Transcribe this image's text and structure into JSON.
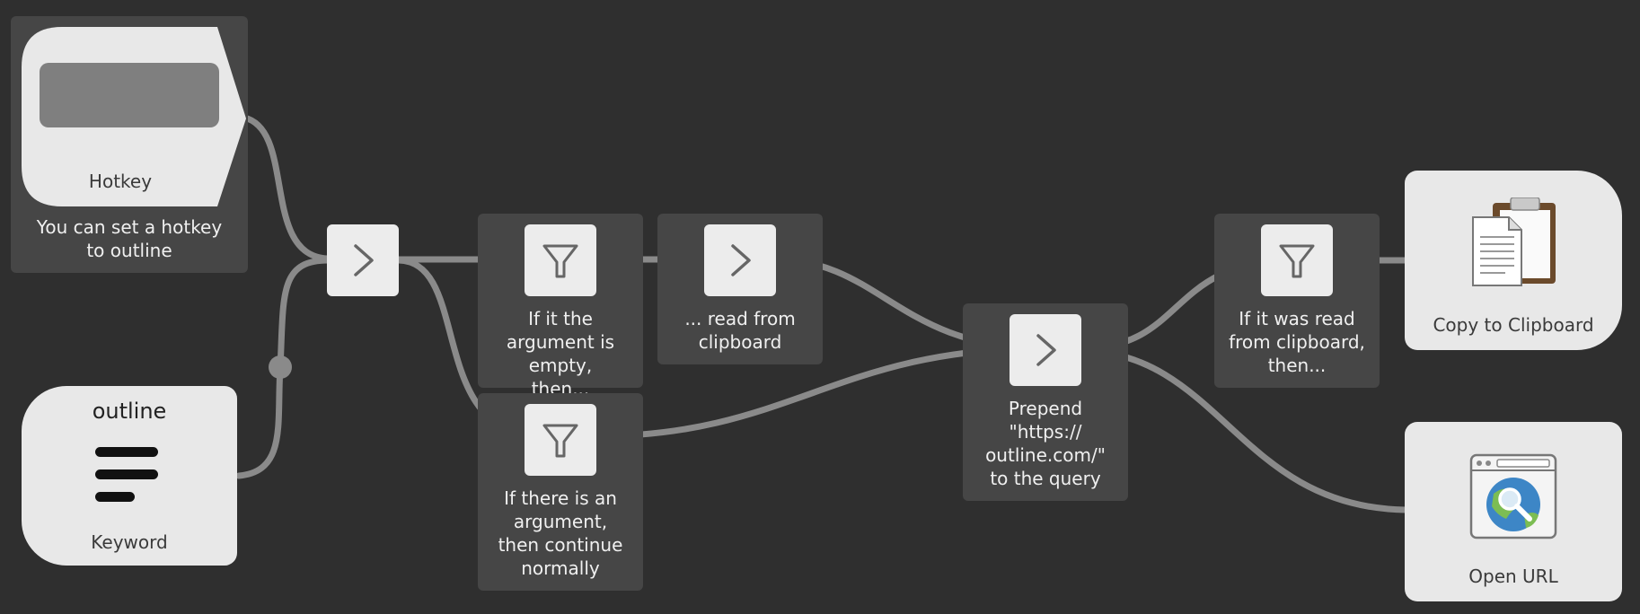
{
  "nodes": {
    "hotkey": {
      "label": "Hotkey",
      "note": "You can set a hotkey to outline",
      "icon": "hotkey-field-icon"
    },
    "keyword": {
      "keyword": "outline",
      "label": "Keyword",
      "icon": "text-lines-icon"
    },
    "arg_check_empty": {
      "note": "If it the argument is empty, then...",
      "icon": "filter-icon"
    },
    "read_clipboard": {
      "note": "... read from clipboard",
      "icon": "chevron-right-icon"
    },
    "arg_present": {
      "note": "If there is an argument, then continue normally",
      "icon": "filter-icon"
    },
    "prepend": {
      "note": "Prepend \"https:// outline.com/\" to the query",
      "icon": "chevron-right-icon"
    },
    "was_clipboard": {
      "note": "If it was read from clipboard, then...",
      "icon": "filter-icon"
    },
    "copy_clipboard": {
      "label": "Copy to Clipboard",
      "icon": "clipboard-icon"
    },
    "open_url": {
      "label": "Open URL",
      "icon": "browser-globe-icon"
    }
  },
  "colors": {
    "background": "#2f2f2f",
    "wire": "#8a8a8a",
    "group": "#464646",
    "node": "#ececec"
  }
}
